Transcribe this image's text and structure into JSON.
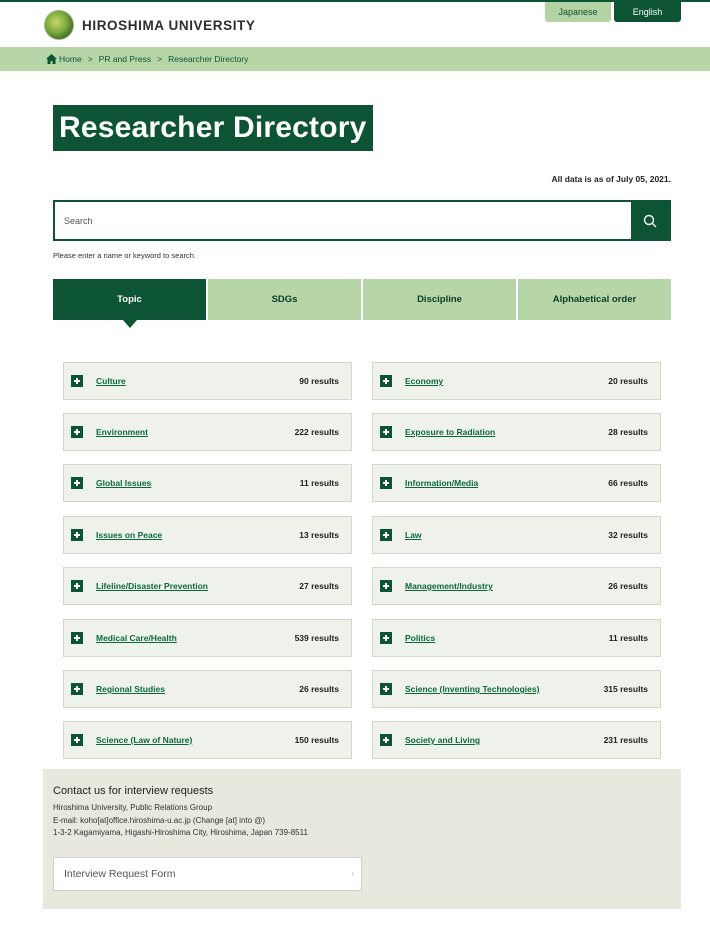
{
  "header": {
    "logo_text": "HIROSHIMA UNIVERSITY",
    "lang_japanese": "Japanese",
    "lang_english": "English"
  },
  "breadcrumb": {
    "home": "Home",
    "sep": ">",
    "pr": "PR and Press",
    "current": "Researcher Directory"
  },
  "page": {
    "title": "Researcher Directory",
    "asof": "All data is as of July 05, 2021."
  },
  "search": {
    "placeholder": "Search",
    "hint": "Please enter a name or keyword to search."
  },
  "tabs": [
    {
      "label": "Topic"
    },
    {
      "label": "SDGs"
    },
    {
      "label": "Discipline"
    },
    {
      "label": "Alphabetical order"
    }
  ],
  "topics": [
    {
      "label": "Culture",
      "count": "90 results"
    },
    {
      "label": "Economy",
      "count": "20 results"
    },
    {
      "label": "Environment",
      "count": "222 results"
    },
    {
      "label": "Exposure to Radiation",
      "count": "28 results"
    },
    {
      "label": "Global Issues",
      "count": "11 results"
    },
    {
      "label": "Information/Media",
      "count": "66 results"
    },
    {
      "label": "Issues on Peace",
      "count": "13 results"
    },
    {
      "label": "Law",
      "count": "32 results"
    },
    {
      "label": "Lifeline/Disaster Prevention",
      "count": "27 results"
    },
    {
      "label": "Management/Industry",
      "count": "26 results"
    },
    {
      "label": "Medical Care/Health",
      "count": "539 results"
    },
    {
      "label": "Politics",
      "count": "11 results"
    },
    {
      "label": "Regional Studies",
      "count": "26 results"
    },
    {
      "label": "Science (Inventing Technologies)",
      "count": "315 results"
    },
    {
      "label": "Science (Law of Nature)",
      "count": "150 results"
    },
    {
      "label": "Society and Living",
      "count": "231 results"
    }
  ],
  "contact": {
    "title": "Contact us for interview requests",
    "org": "Hiroshima University, Public Relations Group",
    "email": "E-mail: koho[at]office.hiroshima-u.ac.jp (Change [at] into @)",
    "address": "1-3-2 Kagamiyama, Higashi-Hiroshima City, Hiroshima, Japan 739-8511",
    "form_button": "Interview Request Form",
    "form_arrow": "›"
  },
  "colors": {
    "brand_green": "#0c5433",
    "light_green": "#b7d6a8",
    "card_bg": "#eef2ea",
    "contact_bg": "#e8e8de"
  }
}
